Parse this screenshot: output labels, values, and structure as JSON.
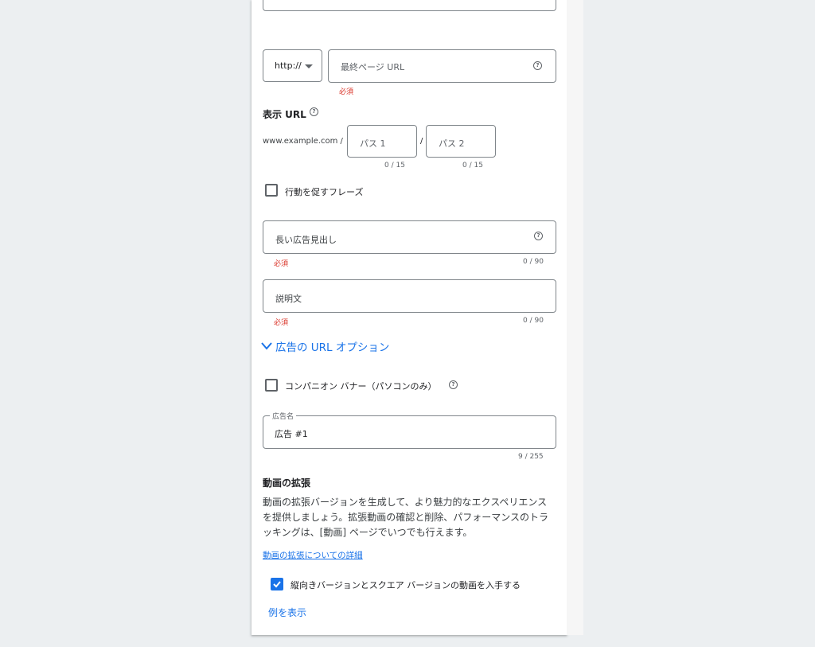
{
  "url_section": {
    "protocol": "http://",
    "final_url_placeholder": "最終ページ URL",
    "required": "必須"
  },
  "display_url": {
    "title": "表示 URL",
    "domain": "www.example.com /",
    "path1_placeholder": "パス 1",
    "separator": "/",
    "path2_placeholder": "パス 2",
    "path1_counter": "0 / 15",
    "path2_counter": "0 / 15"
  },
  "cta": {
    "label": "行動を促すフレーズ"
  },
  "long_headline": {
    "placeholder": "長い広告見出し",
    "required": "必須",
    "counter": "0 / 90"
  },
  "description": {
    "placeholder": "説明文",
    "required": "必須",
    "counter": "0 / 90"
  },
  "url_options": {
    "label": "広告の URL オプション"
  },
  "companion": {
    "label": "コンパニオン バナー（パソコンのみ）"
  },
  "ad_name": {
    "label": "広告名",
    "value": "広告 #1",
    "counter": "9 / 255"
  },
  "video_ext": {
    "title": "動画の拡張",
    "body": "動画の拡張バージョンを生成して、より魅力的なエクスペリエンスを提供しましょう。拡張動画の確認と削除、パフォーマンスのトラッキングは、[動画] ページでいつでも行えます。",
    "learn_more": "動画の拡張についての詳細",
    "checkbox_label": "縦向きバージョンとスクエア バージョンの動画を入手する",
    "show_examples": "例を表示"
  },
  "colors": {
    "accent": "#1a73e8",
    "error": "#d93025",
    "border": "#80868b",
    "background": "#eceff1"
  }
}
